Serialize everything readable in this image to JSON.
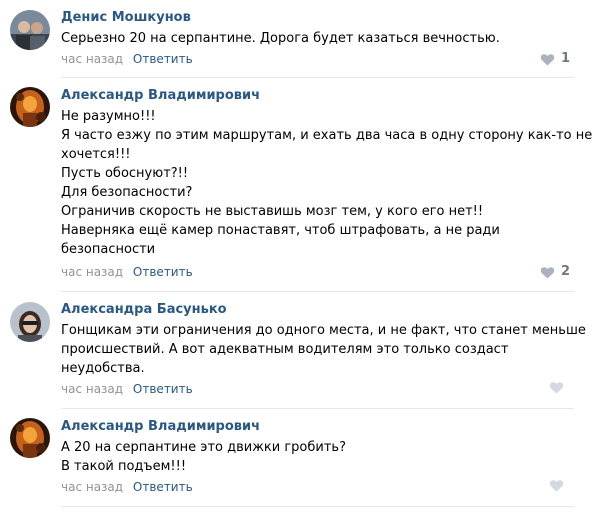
{
  "comments": [
    {
      "author": "Денис Мошкунов",
      "lines": [
        "Серьезно 20 на серпантине. Дорога будет казаться вечностью."
      ],
      "time": "час назад",
      "reply_label": "Ответить",
      "likes": "1"
    },
    {
      "author": "Александр Владимирович",
      "lines": [
        "Не разумно!!!",
        "Я часто езжу по этим маршрутам, и ехать два часа в одну сторону как-то не",
        "хочется!!!",
        "Пусть обоснуют?!!",
        "Для безопасности?",
        "Ограничив скорость не выставишь мозг тем, у кого его нет!!",
        "Наверняка ещё камер понаставят, чтоб штрафовать, а не ради",
        "безопасности"
      ],
      "time": "час назад",
      "reply_label": "Ответить",
      "likes": "2"
    },
    {
      "author": "Александра Басунько",
      "lines": [
        "Гонщикам эти ограничения до одного места, и не факт, что станет меньше",
        "происшествий. А вот адекватным водителям это только создаст",
        "неудобства."
      ],
      "time": "час назад",
      "reply_label": "Ответить",
      "likes": ""
    },
    {
      "author": "Александр Владимирович",
      "lines": [
        "А 20 на серпантине это движки гробить?",
        "В такой подъем!!!"
      ],
      "time": "час назад",
      "reply_label": "Ответить",
      "likes": ""
    }
  ],
  "colors": {
    "author": "#2a5885",
    "meta": "#939393",
    "like_icon": "#aab2bd",
    "divider": "#e7e8ec"
  },
  "icons": {
    "like": "heart-icon"
  }
}
